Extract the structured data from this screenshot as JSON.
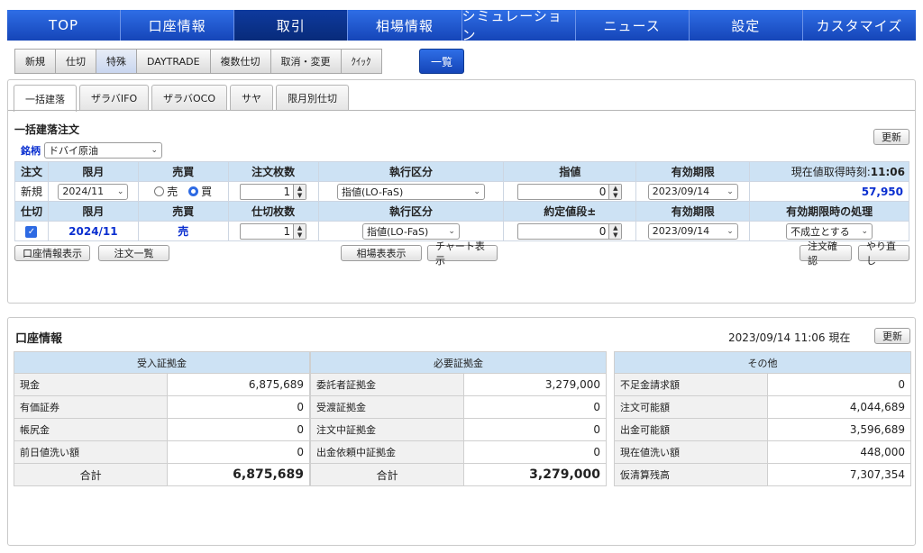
{
  "nav": [
    "TOP",
    "口座情報",
    "取引",
    "相場情報",
    "シミュレーション",
    "ニュース",
    "設定",
    "カスタマイズ"
  ],
  "nav_active": 2,
  "subtabs": [
    "新規",
    "仕切",
    "特殊",
    "DAYTRADE",
    "複数仕切",
    "取消・変更",
    "ｸｲｯｸ"
  ],
  "subtab_active": 2,
  "ichiran": "一覧",
  "inner_tabs": [
    "一括建落",
    "ザラバIFO",
    "ザラバOCO",
    "サヤ",
    "限月別仕切"
  ],
  "inner_active": 0,
  "section_title": "一括建落注文",
  "refresh": "更新",
  "brand": {
    "label": "銘柄",
    "value": "ドバイ原油"
  },
  "row1_headers": [
    "注文",
    "限月",
    "売買",
    "注文枚数",
    "執行区分",
    "指値",
    "有効期限"
  ],
  "price_time_label": "現在値取得時刻:",
  "price_time": "11:06",
  "row1": {
    "type": "新規",
    "month": "2024/11",
    "sell_label": "売",
    "buy_label": "買",
    "qty": "1",
    "exec": "指値(LO-FaS)",
    "limit": "0",
    "expiry": "2023/09/14",
    "price": "57,950"
  },
  "row2_headers": [
    "仕切",
    "限月",
    "売買",
    "仕切枚数",
    "執行区分",
    "約定値段±",
    "有効期限",
    "有効期限時の処理"
  ],
  "row2": {
    "check": "✓",
    "month": "2024/11",
    "side": "売",
    "qty": "1",
    "exec": "指値(LO-FaS)",
    "price_diff": "0",
    "expiry": "2023/09/14",
    "expiry_action": "不成立とする"
  },
  "buttons": {
    "acct_info": "口座情報表示",
    "order_list": "注文一覧",
    "quotes": "相場表表示",
    "chart": "チャート表示",
    "confirm": "注文確認",
    "redo": "やり直し"
  },
  "account": {
    "title": "口座情報",
    "timestamp": "2023/09/14  11:06 現在",
    "deposit_header": "受入証拠金",
    "required_header": "必要証拠金",
    "other_header": "その他",
    "deposit": [
      {
        "label": "現金",
        "value": "6,875,689"
      },
      {
        "label": "有価証券",
        "value": "0"
      },
      {
        "label": "帳尻金",
        "value": "0"
      },
      {
        "label": "前日値洗い額",
        "value": "0"
      }
    ],
    "required": [
      {
        "label": "委託者証拠金",
        "value": "3,279,000"
      },
      {
        "label": "受渡証拠金",
        "value": "0"
      },
      {
        "label": "注文中証拠金",
        "value": "0"
      },
      {
        "label": "出金依頼中証拠金",
        "value": "0"
      }
    ],
    "other": [
      {
        "label": "不足金請求額",
        "value": "0"
      },
      {
        "label": "注文可能額",
        "value": "4,044,689"
      },
      {
        "label": "出金可能額",
        "value": "3,596,689"
      },
      {
        "label": "現在値洗い額",
        "value": "448,000"
      },
      {
        "label": "仮清算残高",
        "value": "7,307,354"
      }
    ],
    "total_label": "合計",
    "deposit_total": "6,875,689",
    "required_total": "3,279,000"
  }
}
